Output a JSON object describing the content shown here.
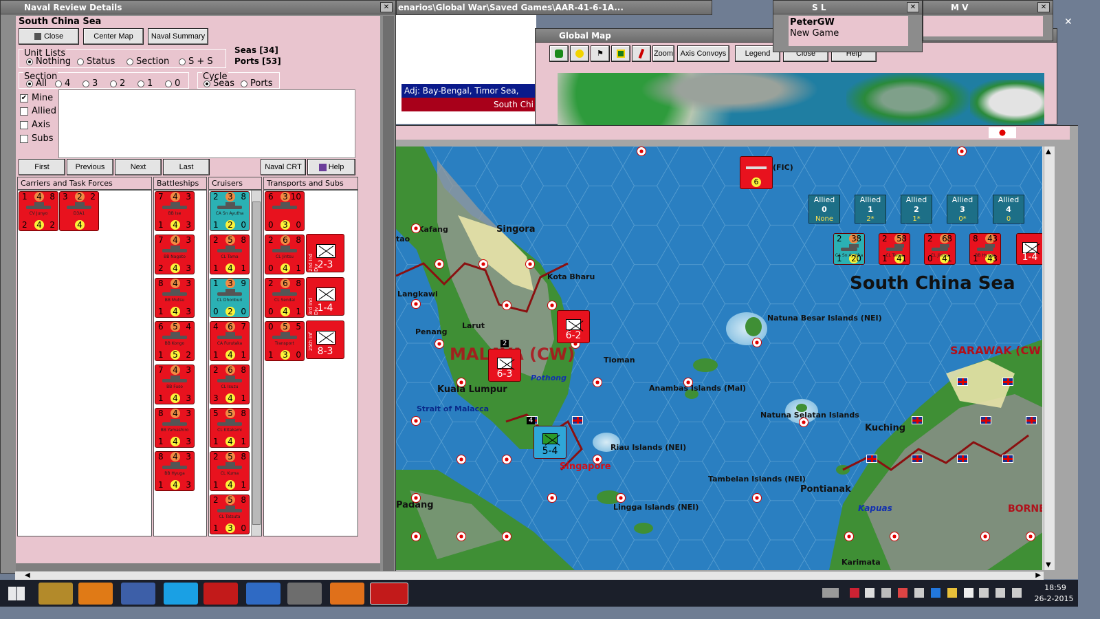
{
  "naval_window": {
    "title": "Naval Review Details",
    "sea_name": "South China Sea",
    "buttons": {
      "close": "Close",
      "center_map": "Center Map",
      "naval_summary": "Naval Summary"
    },
    "unit_lists": {
      "label": "Unit Lists",
      "options": [
        "Nothing",
        "Status",
        "Section",
        "S + S"
      ],
      "selected": "Nothing"
    },
    "counts": {
      "seas": "Seas [34]",
      "ports": "Ports [53]"
    },
    "section": {
      "label": "Section",
      "options": [
        "All",
        "4",
        "3",
        "2",
        "1",
        "0"
      ],
      "selected": "All"
    },
    "cycle": {
      "label": "Cycle",
      "options": [
        "Seas",
        "Ports"
      ],
      "selected": "Seas"
    },
    "filters": [
      {
        "label": "Mine",
        "checked": true
      },
      {
        "label": "Allied",
        "checked": false
      },
      {
        "label": "Axis",
        "checked": false
      },
      {
        "label": "Subs",
        "checked": false
      }
    ],
    "nav_buttons": {
      "first": "First",
      "previous": "Previous",
      "next": "Next",
      "last": "Last",
      "naval_crt": "Naval CRT",
      "help": "Help"
    },
    "columns": {
      "carriers": "Carriers and Task Forces",
      "battleships": "Battleships",
      "cruisers": "Cruisers",
      "transports": "Transports and Subs"
    }
  },
  "carriers": [
    {
      "tl": "1",
      "tc": "4",
      "tr": "8",
      "bl": "2",
      "bc": "4",
      "br": "2",
      "name": "CV Junyo"
    },
    {
      "tl": "3",
      "tc": "2",
      "tr": "2",
      "bl": "",
      "bc": "4",
      "br": "",
      "name": "D3A1"
    }
  ],
  "battleships": [
    {
      "tl": "7",
      "tc": "4",
      "tr": "3",
      "bl": "1",
      "bc": "4",
      "br": "3",
      "name": "BB Ise"
    },
    {
      "tl": "7",
      "tc": "4",
      "tr": "3",
      "bl": "2",
      "bc": "4",
      "br": "3",
      "name": "BB Nagato"
    },
    {
      "tl": "8",
      "tc": "4",
      "tr": "3",
      "bl": "1",
      "bc": "4",
      "br": "3",
      "name": "BB Mutsu"
    },
    {
      "tl": "6",
      "tc": "5",
      "tr": "4",
      "bl": "1",
      "bc": "5",
      "br": "2",
      "name": "BB Kongo"
    },
    {
      "tl": "7",
      "tc": "4",
      "tr": "3",
      "bl": "1",
      "bc": "4",
      "br": "3",
      "name": "BB Fuso"
    },
    {
      "tl": "8",
      "tc": "4",
      "tr": "3",
      "bl": "1",
      "bc": "4",
      "br": "3",
      "name": "BB Yamashiro"
    },
    {
      "tl": "8",
      "tc": "4",
      "tr": "3",
      "bl": "1",
      "bc": "4",
      "br": "3",
      "name": "BB Hyuga"
    }
  ],
  "cruisers": [
    {
      "tl": "2",
      "tc": "3",
      "tr": "8",
      "bl": "1",
      "bc": "2",
      "br": "0",
      "name": "CA Sn Ayutha",
      "teal": true
    },
    {
      "tl": "2",
      "tc": "5",
      "tr": "8",
      "bl": "1",
      "bc": "4",
      "br": "1",
      "name": "CL Tama"
    },
    {
      "tl": "1",
      "tc": "3",
      "tr": "9",
      "bl": "0",
      "bc": "2",
      "br": "0",
      "name": "CL Dhonburi",
      "teal": true
    },
    {
      "tl": "4",
      "tc": "6",
      "tr": "7",
      "bl": "1",
      "bc": "4",
      "br": "1",
      "name": "CA Furutaka"
    },
    {
      "tl": "2",
      "tc": "6",
      "tr": "8",
      "bl": "3",
      "bc": "4",
      "br": "1",
      "name": "CL Isuzu"
    },
    {
      "tl": "5",
      "tc": "5",
      "tr": "8",
      "bl": "1",
      "bc": "4",
      "br": "1",
      "name": "CL Kitakami"
    },
    {
      "tl": "2",
      "tc": "5",
      "tr": "8",
      "bl": "1",
      "bc": "4",
      "br": "1",
      "name": "CL Kuma"
    },
    {
      "tl": "2",
      "tc": "5",
      "tr": "8",
      "bl": "1",
      "bc": "3",
      "br": "0",
      "name": "CL Tatsuta"
    }
  ],
  "transports": [
    {
      "tl": "6",
      "tc": "3",
      "tr": "10",
      "bl": "0",
      "bc": "3",
      "br": "0",
      "name": ""
    },
    {
      "tl": "2",
      "tc": "6",
      "tr": "8",
      "bl": "0",
      "bc": "4",
      "br": "1",
      "name": "CL Jintsu"
    },
    {
      "tl": "2",
      "tc": "6",
      "tr": "8",
      "bl": "0",
      "bc": "4",
      "br": "1",
      "name": "CL Sendai"
    },
    {
      "tl": "0",
      "tc": "5",
      "tr": "5",
      "bl": "1",
      "bc": "3",
      "br": "0",
      "name": "Transport"
    }
  ],
  "armies": [
    {
      "top": "2nd Ind Div",
      "val": "2-3"
    },
    {
      "top": "3rd Ind Div",
      "val": "1-4"
    },
    {
      "top": "25th Inf",
      "val": "8-3"
    }
  ],
  "map_window": {
    "path_title": "enarios\\Global War\\Saved Games\\AAR-41-6-1A...",
    "adjacent": "Adj: Bay-Bengal, Timor Sea,",
    "adjacent2": "South Chi"
  },
  "global_map": {
    "title": "Global Map",
    "buttons": [
      "Zoom",
      "Axis Convoys",
      "Legend",
      "Close",
      "Help"
    ]
  },
  "sl_window": {
    "title": "S L",
    "player": "PeterGW",
    "status": "New Game"
  },
  "mv_window": {
    "title": "M V"
  },
  "map": {
    "sea_title": "South China Sea",
    "labels": {
      "singora": "Singora",
      "kafang": "Kafang",
      "tao": "tao",
      "kota_bharu": "Kota Bharu",
      "langkawi": "Langkawi",
      "penang": "Penang",
      "larut": "Larut",
      "malaya": "MALAYA (CW)",
      "tioman": "Tioman",
      "pothong": "Pothong",
      "kuala_lumpur": "Kuala Lumpur",
      "strait": "Strait of Malacca",
      "singapore": "Singapore",
      "riau": "Riau Islands (NEI)",
      "natuna_besar": "Natuna Besar Islands (NEI)",
      "anambas": "Anambas Islands (Mal)",
      "natuna_selatan": "Natuna Selatan Islands",
      "kuching": "Kuching",
      "sarawak": "SARAWAK (CW",
      "tambelan": "Tambelan Islands (NEI)",
      "pontianak": "Pontianak",
      "kapuas": "Kapuas",
      "borneo": "BORNE",
      "lingga": "Lingga Islands (NEI)",
      "padang": "Padang",
      "karimata": "Karimata",
      "fic": "(FIC)",
      "stack_n": "2",
      "stack_s": "4"
    },
    "allied": [
      {
        "label": "Allied",
        "n": "0",
        "v": "None"
      },
      {
        "label": "Allied",
        "n": "1",
        "v": "2*"
      },
      {
        "label": "Allied",
        "n": "2",
        "v": "1*"
      },
      {
        "label": "Allied",
        "n": "3",
        "v": "0*"
      },
      {
        "label": "Allied",
        "n": "4",
        "v": "0"
      }
    ],
    "units": {
      "kota_army": "6-2",
      "malaya_army": "6-3",
      "singapore_army": "5-4",
      "fic_air": "6",
      "tf_army": "1-4"
    }
  },
  "taskbar": {
    "time": "18:59",
    "date": "26-2-2015"
  }
}
